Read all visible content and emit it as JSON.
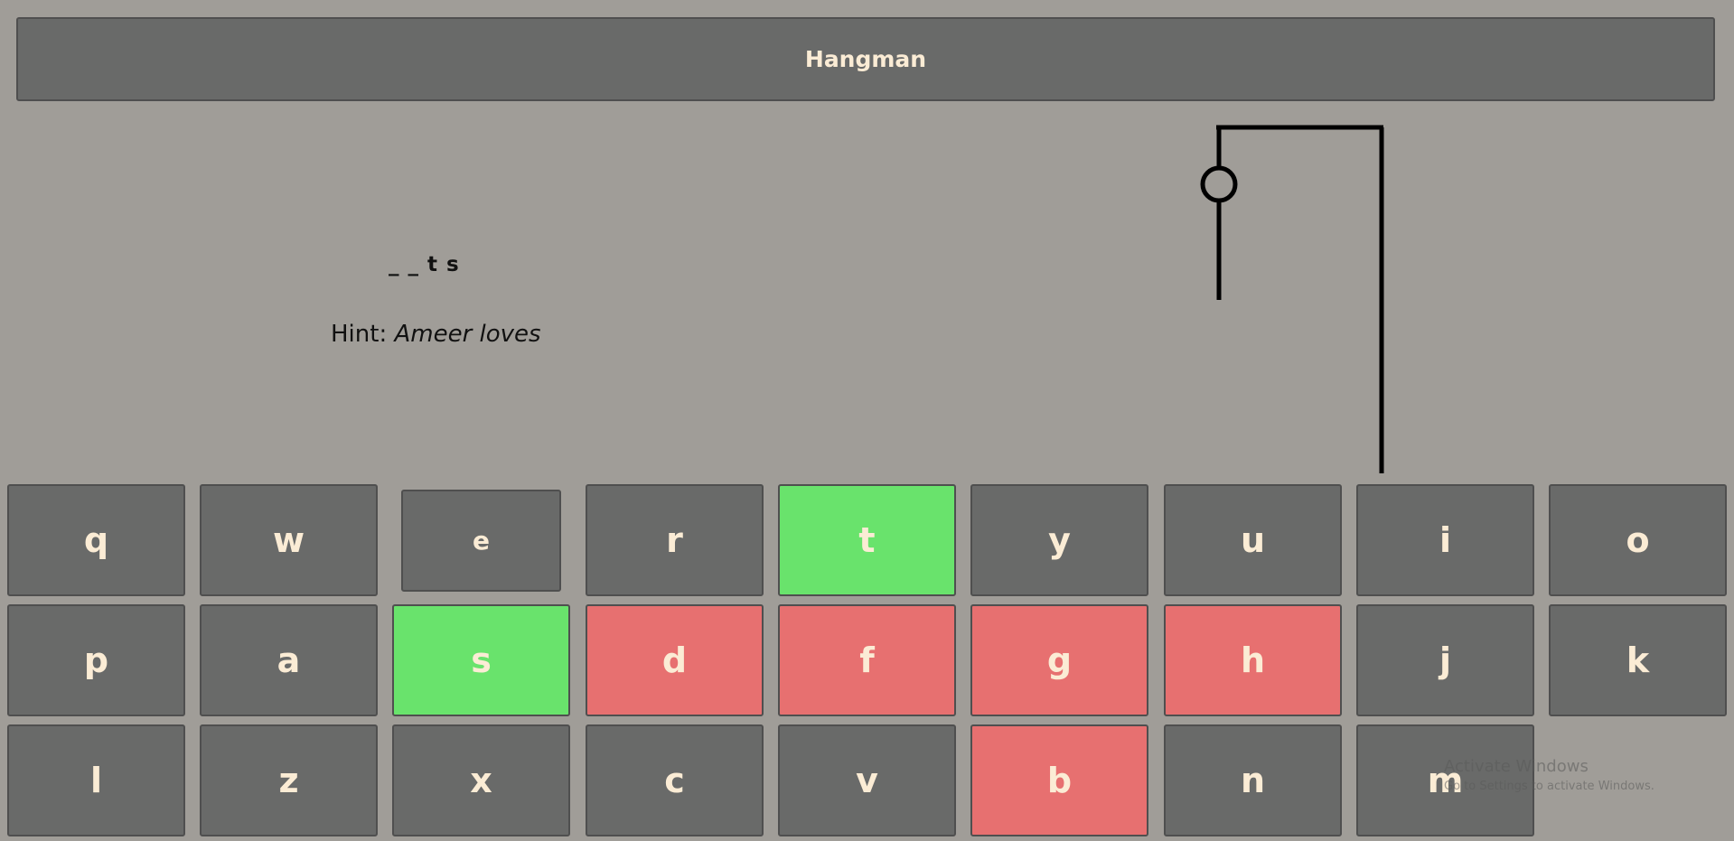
{
  "header": {
    "title": "Hangman"
  },
  "word": {
    "display": "_ _ t s"
  },
  "hint": {
    "label": "Hint:",
    "value": "Ameer loves"
  },
  "keyboard": {
    "rows": [
      [
        {
          "letter": "q",
          "state": "default"
        },
        {
          "letter": "w",
          "state": "default"
        },
        {
          "letter": "e",
          "state": "default"
        },
        {
          "letter": "r",
          "state": "default"
        },
        {
          "letter": "t",
          "state": "correct"
        },
        {
          "letter": "y",
          "state": "default"
        },
        {
          "letter": "u",
          "state": "default"
        },
        {
          "letter": "i",
          "state": "default"
        },
        {
          "letter": "o",
          "state": "default"
        }
      ],
      [
        {
          "letter": "p",
          "state": "default"
        },
        {
          "letter": "a",
          "state": "default"
        },
        {
          "letter": "s",
          "state": "correct"
        },
        {
          "letter": "d",
          "state": "wrong"
        },
        {
          "letter": "f",
          "state": "wrong"
        },
        {
          "letter": "g",
          "state": "wrong"
        },
        {
          "letter": "h",
          "state": "wrong"
        },
        {
          "letter": "j",
          "state": "default"
        },
        {
          "letter": "k",
          "state": "default"
        }
      ],
      [
        {
          "letter": "l",
          "state": "default"
        },
        {
          "letter": "z",
          "state": "default"
        },
        {
          "letter": "x",
          "state": "default"
        },
        {
          "letter": "c",
          "state": "default"
        },
        {
          "letter": "v",
          "state": "default"
        },
        {
          "letter": "b",
          "state": "wrong"
        },
        {
          "letter": "n",
          "state": "default"
        },
        {
          "letter": "m",
          "state": "default"
        }
      ]
    ]
  },
  "watermark": {
    "title": "Activate Windows",
    "subtitle": "Go to Settings to activate Windows."
  },
  "colors": {
    "background": "#a09d98",
    "key": "#696a69",
    "key_text": "#fbecd5",
    "correct": "#69e36c",
    "wrong": "#e77070"
  }
}
